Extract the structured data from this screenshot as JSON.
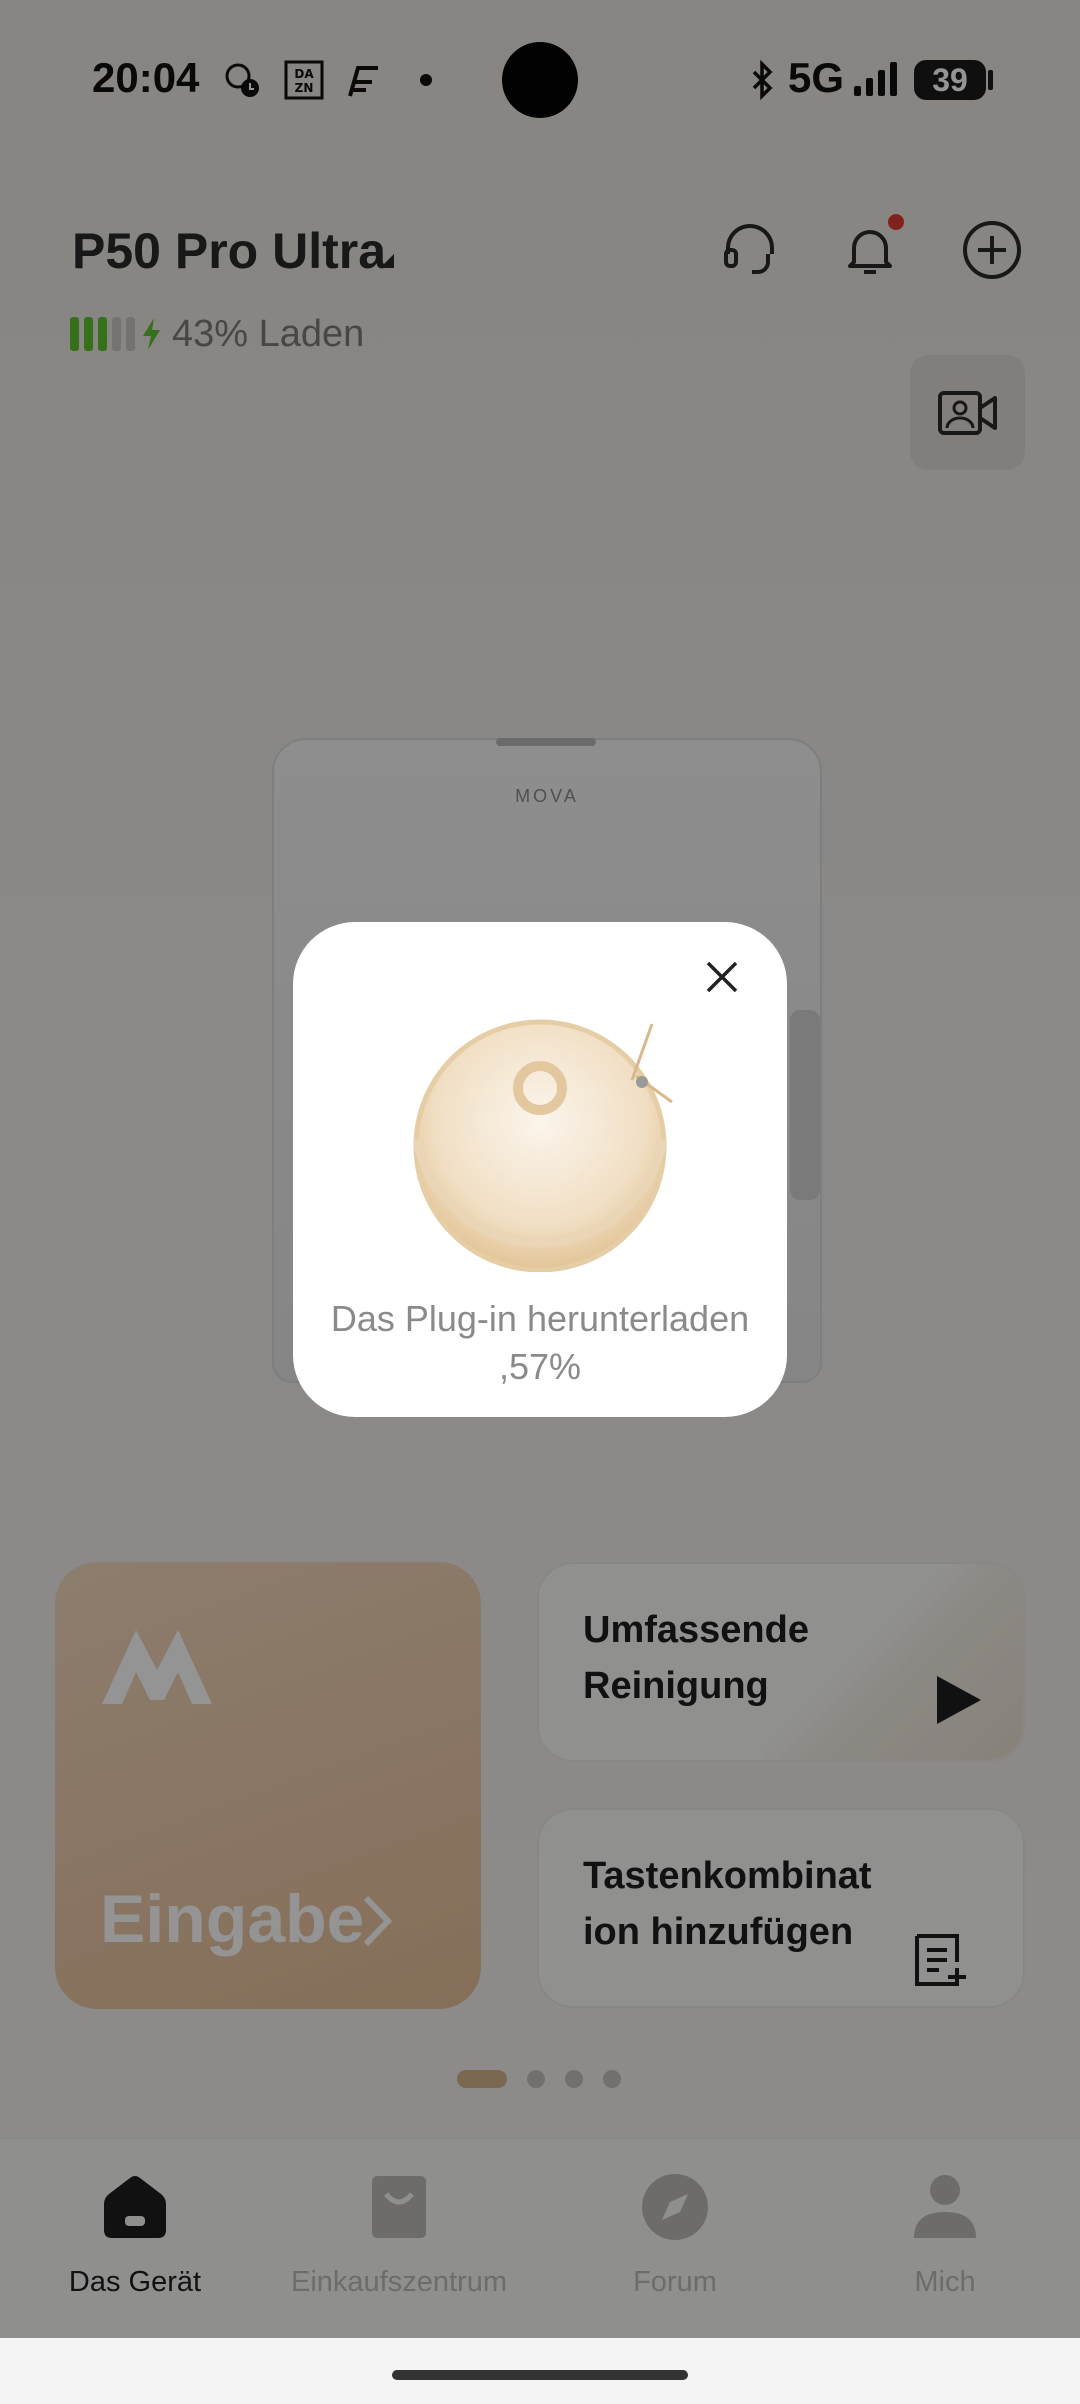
{
  "status_bar": {
    "time": "20:04",
    "network": "5G",
    "battery_level": "39",
    "icons": [
      "weather-sync-icon",
      "dazn-app-icon",
      "fuel-app-icon",
      "dot-icon",
      "bluetooth-icon",
      "signal-strength-icon",
      "battery-icon"
    ]
  },
  "header": {
    "device_name": "P50 Pro Ultra",
    "battery_percent": 43,
    "battery_status": "43% Laden",
    "battery_segments_filled": 3,
    "battery_segments_total": 5
  },
  "dock": {
    "brand": "MOVA"
  },
  "modal": {
    "message": "Das Plug-in herunterladen ,57%",
    "progress_percent": 57
  },
  "cards": {
    "enter_label": "Eingabe",
    "full_clean_label": "Umfassende Reinigung",
    "add_shortcut_label": "Tastenkombinat ion hinzufügen"
  },
  "pagination": {
    "total": 4,
    "active_index": 0
  },
  "bottom_nav": {
    "items": [
      {
        "label": "Das Gerät",
        "icon": "home-icon",
        "active": true
      },
      {
        "label": "Einkaufszentrum",
        "icon": "shopping-bag-icon",
        "active": false
      },
      {
        "label": "Forum",
        "icon": "compass-icon",
        "active": false
      },
      {
        "label": "Mich",
        "icon": "profile-icon",
        "active": false
      }
    ]
  },
  "colors": {
    "accent_gold": "#d5b38b",
    "battery_green": "#5cc12f",
    "notification_red": "#e03c31"
  }
}
